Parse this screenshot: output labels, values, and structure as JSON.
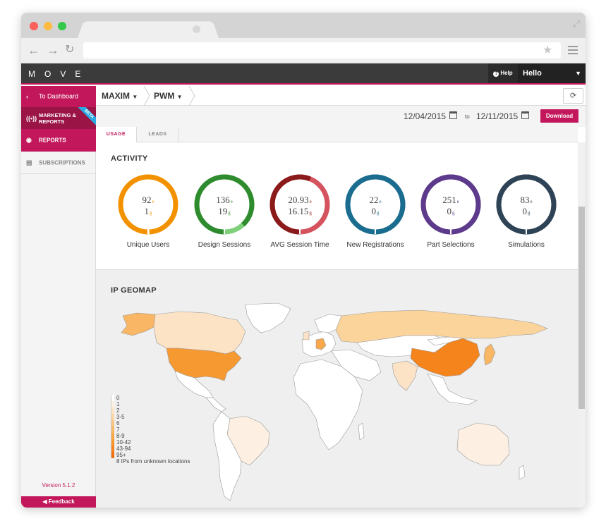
{
  "app": {
    "logo": "MOVE",
    "help_label": "Help",
    "user_label": "Hello"
  },
  "sidebar": {
    "items": [
      {
        "label": "To Dashboard",
        "icon": "chevron-left-icon"
      },
      {
        "label": "MARKETING & REPORTS",
        "icon": "broadcast-icon",
        "badge": "BETA"
      },
      {
        "label": "REPORTS",
        "icon": "reports-icon"
      },
      {
        "label": "SUBSCRIPTIONS",
        "icon": "subscriptions-icon"
      }
    ],
    "version": "Version 5.1.2",
    "feedback": "Feedback"
  },
  "breadcrumb": {
    "company": "MAXIM",
    "product": "PWM"
  },
  "daterange": {
    "from": "12/04/2015",
    "to_label": "to",
    "to": "12/11/2015",
    "download": "Download"
  },
  "tabs": [
    {
      "label": "USAGE",
      "active": true
    },
    {
      "label": "LEADS",
      "active": false
    }
  ],
  "activity": {
    "title": "ACTIVITY",
    "metrics": [
      {
        "label": "Unique Users",
        "v1": "92",
        "s1": "e",
        "v2": "1",
        "s2": "g",
        "color": "#f39200",
        "light": "#fcd9a3",
        "frac": 0.99
      },
      {
        "label": "Design Sessions",
        "v1": "136",
        "s1": "e",
        "v2": "19",
        "s2": "g",
        "color": "#2e8b2e",
        "light": "#7fd07a",
        "frac": 0.88
      },
      {
        "label": "AVG Session Time",
        "v1": "20.93",
        "s1": "e",
        "v2": "16.15",
        "s2": "g",
        "color": "#8b1a1a",
        "light": "#d4535e",
        "frac": 0.56
      },
      {
        "label": "New Registrations",
        "v1": "22",
        "s1": "e",
        "v2": "0",
        "s2": "g",
        "color": "#1a6d8f",
        "light": "#1a6d8f",
        "frac": 1.0
      },
      {
        "label": "Part Selections",
        "v1": "251",
        "s1": "e",
        "v2": "0",
        "s2": "g",
        "color": "#5e3a8c",
        "light": "#5e3a8c",
        "frac": 1.0
      },
      {
        "label": "Simulations",
        "v1": "83",
        "s1": "e",
        "v2": "0",
        "s2": "g",
        "color": "#2f4356",
        "light": "#2f4356",
        "frac": 1.0
      }
    ]
  },
  "geomap": {
    "title": "IP GEOMAP",
    "legend": [
      {
        "label": "0",
        "color": "#ffffff"
      },
      {
        "label": "1",
        "color": "#fdf0e2"
      },
      {
        "label": "2",
        "color": "#fde3c6"
      },
      {
        "label": "3-5",
        "color": "#fcd4a5"
      },
      {
        "label": "6",
        "color": "#fbc584"
      },
      {
        "label": "7",
        "color": "#f9b664"
      },
      {
        "label": "8-9",
        "color": "#f8a74a"
      },
      {
        "label": "10-42",
        "color": "#f79931"
      },
      {
        "label": "43-94",
        "color": "#f4841b"
      },
      {
        "label": "95+",
        "color": "#f07010"
      }
    ],
    "unknown_note": "8 IPs from unknown locations",
    "colors": {
      "usa": "#f79931",
      "china": "#f4841b",
      "canada": "#fde3c6",
      "russia": "#fbd49c",
      "alaska": "#f9b664",
      "germany": "#f8a74a",
      "india": "#fde3c6",
      "australia": "#fdf0e2",
      "brazil": "#fdf0e2",
      "default": "#ffffff"
    }
  }
}
